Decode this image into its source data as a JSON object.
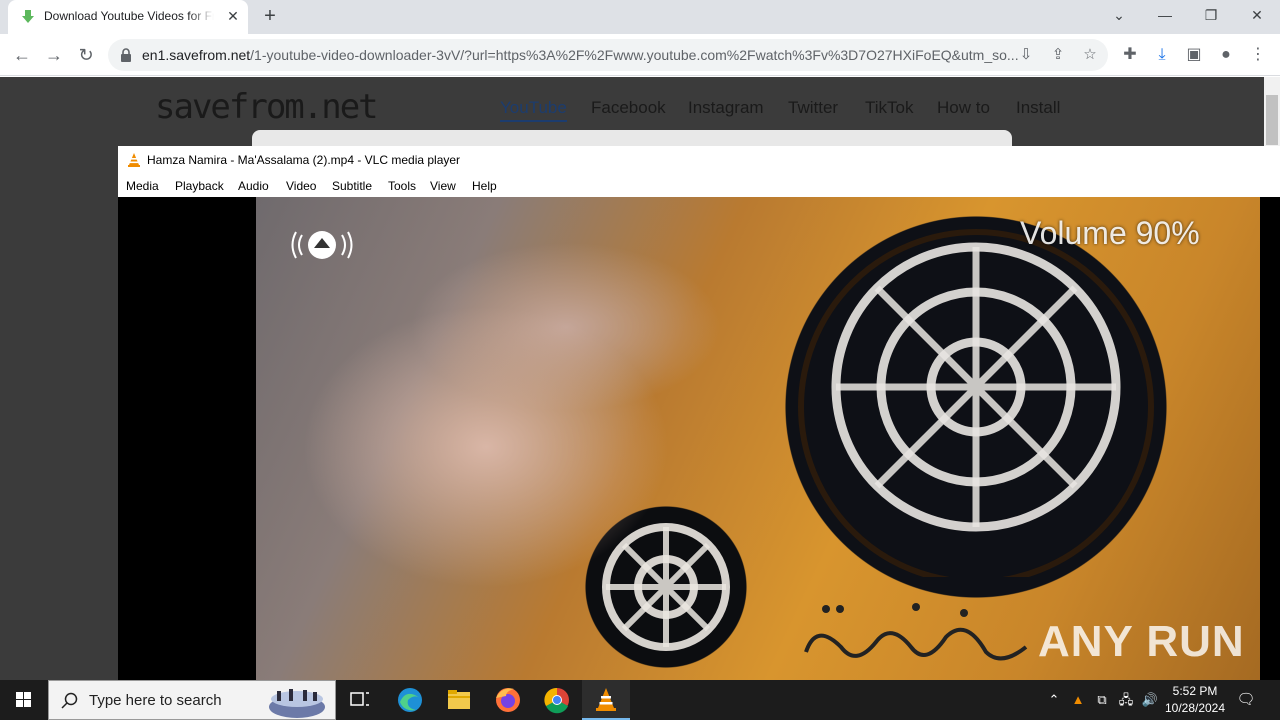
{
  "browser": {
    "tab_title": "Download Youtube Videos for Free",
    "tab_close": "✕",
    "new_tab": "+",
    "url_host": "en1.savefrom.net",
    "url_path": "/1-youtube-video-downloader-3vV/?url=https%3A%2F%2Fwww.youtube.com%2Fwatch%3Fv%3D7O27HXiFoEQ&utm_so..."
  },
  "site": {
    "logo": "savefrom.net",
    "nav": [
      "YouTube",
      "Facebook",
      "Instagram",
      "Twitter",
      "TikTok",
      "How to",
      "Install"
    ]
  },
  "vlc": {
    "title": "Hamza Namira - Ma'Assalama  (2).mp4 - VLC media player",
    "menus": [
      "Media",
      "Playback",
      "Audio",
      "Video",
      "Subtitle",
      "Tools",
      "View",
      "Help"
    ],
    "osd_volume": "Volume 90%",
    "watermark": "ANY RUN"
  },
  "taskbar": {
    "search_placeholder": "Type here to search",
    "time": "5:52 PM",
    "date": "10/28/2024"
  },
  "colors": {
    "chrome_tabstrip": "#dee1e6",
    "page_bg": "#3b3b3b",
    "taskbar": "#1c1c1c",
    "vlc_orange": "#f08c00"
  }
}
